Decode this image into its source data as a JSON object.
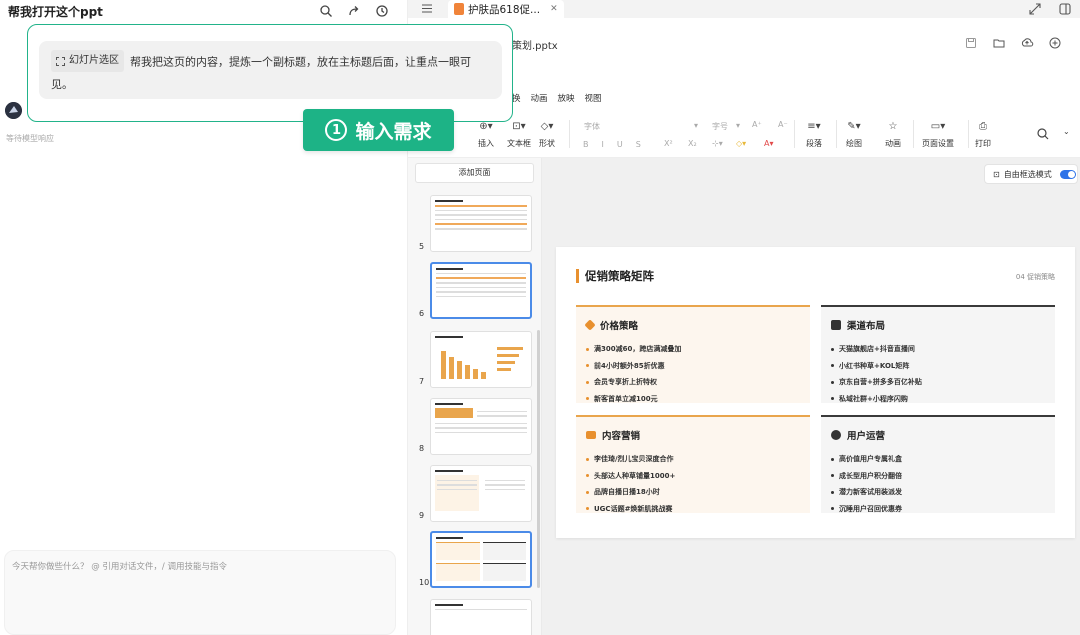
{
  "chat": {
    "title": "帮我打开这个ppt",
    "waiting_text": "等待模型响应",
    "input_placeholder": "今天帮你做些什么？ @ 引用对话文件，/ 调用技能与指令"
  },
  "callout": {
    "chip_label": "幻灯片选区",
    "message": "帮我把这页的内容，提炼一个副标题，放在主标题后面，让重点一眼可见。",
    "step_number": "1",
    "step_label": "输入需求"
  },
  "app": {
    "tab_title": "护肤品618促...",
    "filename_visible": "策划.pptx",
    "menu": [
      "换",
      "动画",
      "放映",
      "视图"
    ],
    "toolbar": {
      "insert": "插入",
      "textbox": "文本框",
      "shape": "形状",
      "font_placeholder": "字体",
      "size_placeholder": "字号",
      "paragraph": "段落",
      "draw": "绘图",
      "animation": "动画",
      "page_setup": "页面设置",
      "print": "打印"
    },
    "add_page": "添加页面",
    "thumb_numbers": [
      "5",
      "6",
      "7",
      "8",
      "9",
      "10"
    ],
    "selected_thumb": "10",
    "lasso_mode": "自由框选模式",
    "lasso_on": true
  },
  "slide": {
    "title": "促销策略矩阵",
    "page_tag": "04 促销策略",
    "cards": [
      {
        "heading": "价格策略",
        "icon": "tag-icon",
        "items": [
          "满300减60，跨店满减叠加",
          "前4小时额外85折优惠",
          "会员专享折上折特权",
          "新客首单立减100元"
        ]
      },
      {
        "heading": "渠道布局",
        "icon": "store-icon",
        "items": [
          "天猫旗舰店+抖音直播间",
          "小红书种草+KOL矩阵",
          "京东自营+拼多多百亿补贴",
          "私域社群+小程序闪购"
        ]
      },
      {
        "heading": "内容营销",
        "icon": "video-icon",
        "items": [
          "李佳琦/烈儿宝贝深度合作",
          "头部达人种草铺量1000+",
          "品牌自播日播18小时",
          "UGC话题#焕新肌挑战赛"
        ]
      },
      {
        "heading": "用户运营",
        "icon": "users-icon",
        "items": [
          "高价值用户专属礼盒",
          "成长型用户积分翻倍",
          "潜力新客试用装派发",
          "沉睡用户召回优惠券"
        ]
      }
    ]
  },
  "colors": {
    "accent": "#1db386",
    "orange": "#e8902e",
    "blue": "#4b8be8"
  }
}
